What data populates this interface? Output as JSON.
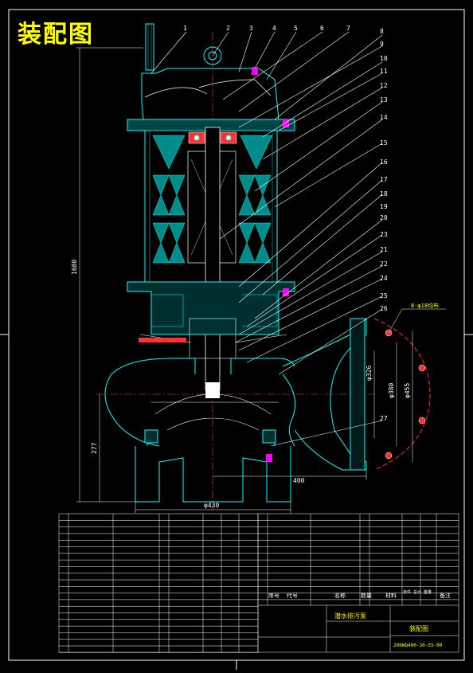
{
  "title": "装配图",
  "callouts": [
    "1",
    "2",
    "3",
    "4",
    "5",
    "6",
    "7",
    "8",
    "9",
    "10",
    "11",
    "12",
    "13",
    "14",
    "15",
    "16",
    "17",
    "18",
    "19",
    "20",
    "23",
    "21",
    "22",
    "24",
    "25",
    "26",
    "27"
  ],
  "dims": {
    "overall_height": "1680",
    "inlet_height": "277",
    "outlet_offset": "400",
    "base_dia": "φ430",
    "flange_dia_1": "φ326",
    "flange_dia_2": "φ380",
    "flange_dia_3": "φ455",
    "bolt_note": "8-φ18均布"
  },
  "title_block": {
    "name": "潜水排污泵",
    "drawing_type": "装配图",
    "drawing_no": "200WQ400-30-55-00",
    "header": [
      "序号",
      "代号",
      "名称",
      "数量",
      "材料",
      "单件 总计 重量",
      "备注"
    ]
  }
}
